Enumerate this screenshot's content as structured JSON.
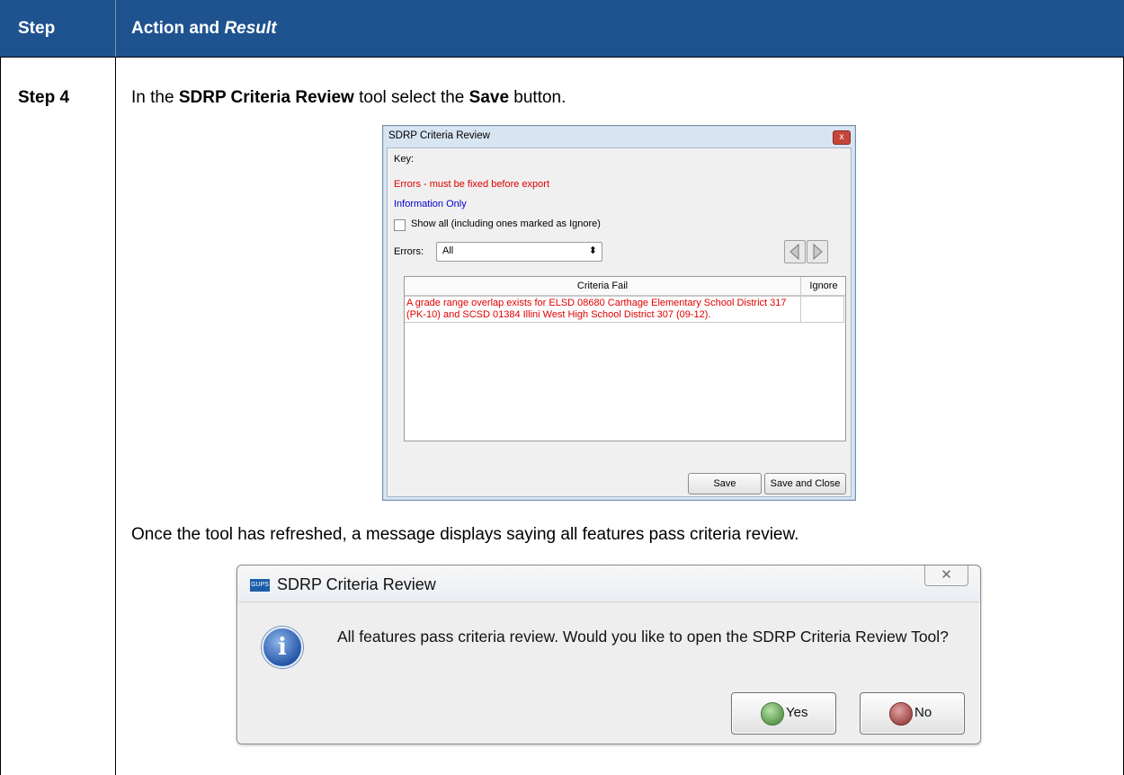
{
  "header": {
    "step_col": "Step",
    "action_col_prefix": "Action and ",
    "action_col_italic": "Result"
  },
  "row": {
    "step_label": "Step 4",
    "instruction_part1": "In the ",
    "instruction_bold1": "SDRP Criteria Review",
    "instruction_part2": " tool select the ",
    "instruction_bold2": "Save",
    "instruction_part3": " button.",
    "after_text": "Once the tool has refreshed, a message displays saying all features pass criteria review."
  },
  "review_dialog": {
    "title": "SDRP Criteria Review",
    "close_glyph": "x",
    "key_label": "Key:",
    "key_errors": "Errors - must be fixed before export",
    "key_info": "Information Only",
    "show_all_label": "Show all (including ones marked as Ignore)",
    "show_all_checked": false,
    "errors_label": "Errors:",
    "errors_filter_value": "All",
    "combo_arrow_glyph": "⬍",
    "nav_prev_icon": "prev-arrow",
    "nav_next_icon": "next-arrow",
    "columns": [
      "Criteria Fail",
      "Ignore"
    ],
    "rows": [
      {
        "criteria": "A grade range overlap exists for ELSD 08680 Carthage Elementary School District 317 (PK-10) and SCSD 01384 Illini West High School District 307 (09-12).",
        "ignore": ""
      }
    ],
    "save_label": "Save",
    "save_close_label": "Save and Close",
    "error_color": "#e00000",
    "info_color": "#0000d0"
  },
  "message_box": {
    "app_icon_text": "GUPS",
    "title": "SDRP Criteria Review",
    "close_glyph": "✕",
    "icon": "info-icon",
    "icon_glyph": "i",
    "message": "All features pass criteria review. Would you like to open the SDRP Criteria Review Tool?",
    "yes_label": "Yes",
    "no_label": "No"
  },
  "colors": {
    "header_bg": "#1f538f",
    "header_text": "#ffffff"
  }
}
